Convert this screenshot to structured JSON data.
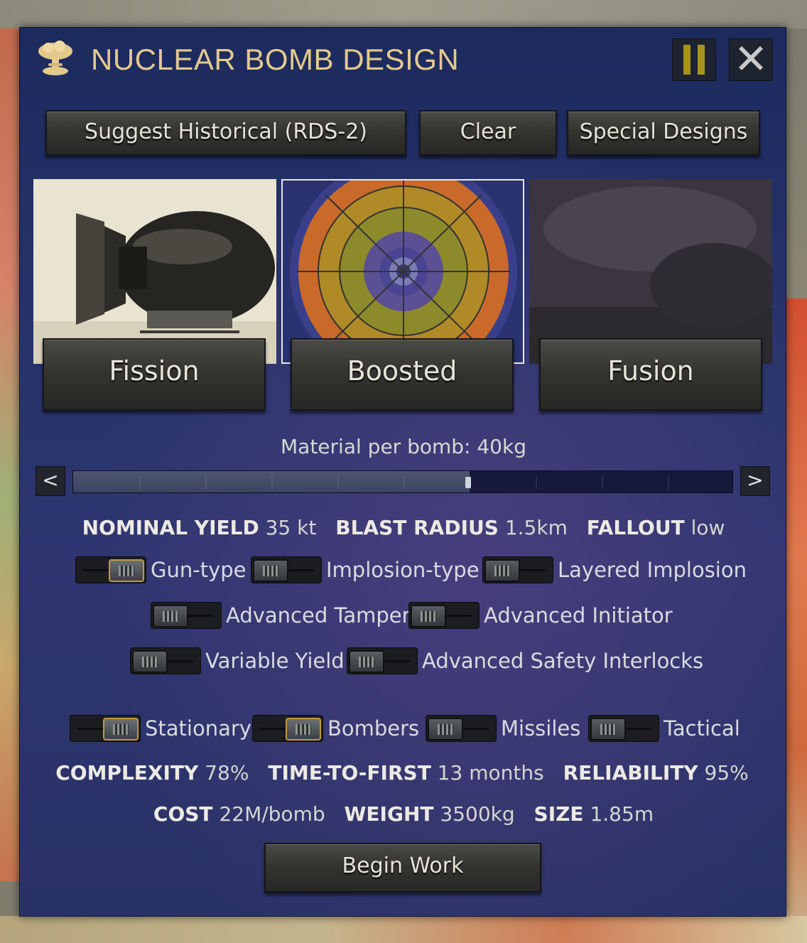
{
  "window": {
    "title": "NUCLEAR BOMB DESIGN"
  },
  "actions": {
    "suggest": "Suggest Historical (RDS-2)",
    "clear": "Clear",
    "special": "Special Designs"
  },
  "types": [
    {
      "label": "Fission",
      "selected": false
    },
    {
      "label": "Boosted",
      "selected": true
    },
    {
      "label": "Fusion",
      "selected": false
    }
  ],
  "material": {
    "text": "Material per bomb: 40kg",
    "slider_fraction": 0.6,
    "prev": "<",
    "next": ">"
  },
  "stats1": {
    "yield_label": "NOMINAL YIELD",
    "yield_value": "35 kt",
    "blast_label": "BLAST RADIUS",
    "blast_value": "1.5km",
    "fallout_label": "FALLOUT",
    "fallout_value": "low"
  },
  "options": {
    "gun": {
      "label": "Gun-type",
      "on": true
    },
    "implosion": {
      "label": "Implosion-type",
      "on": false
    },
    "layered": {
      "label": "Layered Implosion",
      "on": false
    },
    "tamper": {
      "label": "Advanced Tamper",
      "on": false
    },
    "initiator": {
      "label": "Advanced Initiator",
      "on": false
    },
    "variable": {
      "label": "Variable Yield",
      "on": false
    },
    "safety": {
      "label": "Advanced Safety Interlocks",
      "on": false
    }
  },
  "delivery": {
    "stationary": {
      "label": "Stationary",
      "on": true
    },
    "bombers": {
      "label": "Bombers",
      "on": true
    },
    "missiles": {
      "label": "Missiles",
      "on": false
    },
    "tactical": {
      "label": "Tactical",
      "on": false
    }
  },
  "stats2": {
    "complexity_label": "COMPLEXITY",
    "complexity_value": "78%",
    "time_label": "TIME-TO-FIRST",
    "time_value": "13 months",
    "reliability_label": "RELIABILITY",
    "reliability_value": "95%"
  },
  "stats3": {
    "cost_label": "COST",
    "cost_value": "22M/bomb",
    "weight_label": "WEIGHT",
    "weight_value": "3500kg",
    "size_label": "SIZE",
    "size_value": "1.85m"
  },
  "begin": "Begin Work",
  "colors": {
    "title": "#e3c98c",
    "panel": "#26346a",
    "pause": "#a8941a",
    "knob_on_border": "#c19a3c"
  },
  "icons": {
    "title": "mushroom-cloud-icon",
    "pause": "pause-icon",
    "close": "close-icon"
  }
}
